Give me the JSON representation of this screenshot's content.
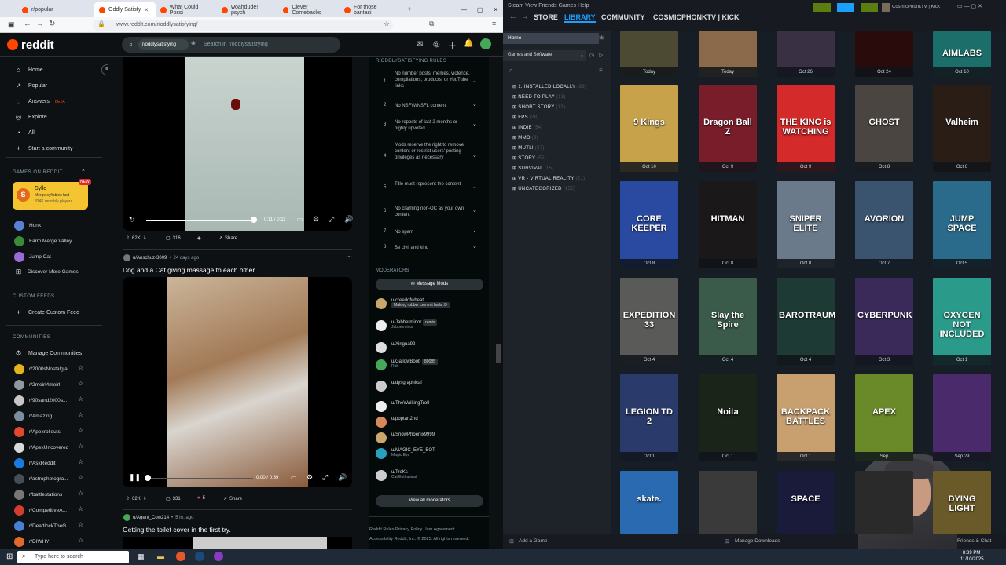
{
  "browser": {
    "tabs": [
      {
        "label": "r/popular"
      },
      {
        "label": "Oddly Satisfy"
      },
      {
        "label": "What Could Possi"
      },
      {
        "label": "woahdude! psych"
      },
      {
        "label": "Clever Comebacks"
      },
      {
        "label": "For those bantasi"
      }
    ],
    "url": "www.reddit.com/r/oddlysatisfying/"
  },
  "reddit": {
    "logo": "reddit",
    "search_chip": "r/oddlysatisfying",
    "search_placeholder": "Search in r/oddlysatisfying",
    "nav": [
      {
        "label": "Home",
        "icon": "home-icon"
      },
      {
        "label": "Popular",
        "icon": "popular-icon"
      },
      {
        "label": "Answers",
        "badge": "BETA",
        "icon": "answers-icon"
      },
      {
        "label": "Explore",
        "icon": "explore-icon"
      },
      {
        "label": "All",
        "icon": "all-icon"
      },
      {
        "label": "Start a community",
        "icon": "plus-icon"
      }
    ],
    "games_heading": "GAMES ON REDDIT",
    "game_card": {
      "title": "Syllo",
      "desc": "Merge syllables fast",
      "players": "334K monthly players",
      "badge": "NEW"
    },
    "games": [
      {
        "label": "Honk"
      },
      {
        "label": "Farm Merge Valley"
      },
      {
        "label": "Jump Cat"
      },
      {
        "label": "Discover More Games"
      }
    ],
    "custom_feeds_heading": "CUSTOM FEEDS",
    "create_feed": "Create Custom Feed",
    "communities_heading": "COMMUNITIES",
    "manage": "Manage Communities",
    "communities": [
      {
        "label": "r/2000sNostalgia",
        "color": "#e4b21a"
      },
      {
        "label": "r/2meirl4meirl",
        "color": "#8f9aa0"
      },
      {
        "label": "r/90sand2000s...",
        "color": "#c7c7c7"
      },
      {
        "label": "r/Amazing",
        "color": "#7a8ea0"
      },
      {
        "label": "r/Apexrollouts",
        "color": "#e2482d"
      },
      {
        "label": "r/ApexUncovered",
        "color": "#d7dadc"
      },
      {
        "label": "r/AskReddit",
        "color": "#1a7ae0"
      },
      {
        "label": "r/astrophotogra...",
        "color": "#444e57"
      },
      {
        "label": "r/battlestations",
        "color": "#777"
      },
      {
        "label": "r/CompetitiveA...",
        "color": "#d13e2e"
      },
      {
        "label": "r/DeadlockTheG...",
        "color": "#4a7fd6"
      },
      {
        "label": "r/DIWHY",
        "color": "#e0692c"
      }
    ],
    "post1": {
      "time_current": "0:11",
      "time_total": "0:11",
      "votes": "62K",
      "comments": "316",
      "share": "Share"
    },
    "post2": {
      "author": "u/Anschuz-3009",
      "age": "24 days ago",
      "title": "Dog and a Cat giving massage to each other",
      "time_current": "0:00",
      "time_total": "0:39",
      "votes": "62K",
      "comments": "331",
      "awards": "5",
      "share": "Share"
    },
    "post3": {
      "author": "u/Agent_Cow214",
      "age": "5 hr. ago",
      "title": "Getting the toilet cover in the first try."
    },
    "rules_heading": "R/ODDLYSATISFYING RULES",
    "rules": [
      {
        "n": "1",
        "text": "No number posts, memes, violence, compilations, products, or YouTube links"
      },
      {
        "n": "2",
        "text": "No NSFW/NSFL content"
      },
      {
        "n": "3",
        "text": "No reposts of last 2 months or highly upvoted"
      },
      {
        "n": "4",
        "text": "Mods reserve the right to remove content or restrict users' posting privileges as necessary"
      },
      {
        "n": "5",
        "text": "Title must represent the content"
      },
      {
        "n": "6",
        "text": "No claiming non-OC as your own content"
      },
      {
        "n": "7",
        "text": "No spam"
      },
      {
        "n": "8",
        "text": "Be civil and kind"
      }
    ],
    "moderators_heading": "MODERATORS",
    "message_mods": "Message Mods",
    "moderators": [
      {
        "name": "u/creedofwheat",
        "flair": "Making rubber cement balls :D"
      },
      {
        "name": "u/Jabberminor",
        "flair": "remix",
        "sub": "Jabberminor"
      },
      {
        "name": "u/Xingua92"
      },
      {
        "name": "u/GallowBoob",
        "flair": "80085",
        "sub": "Rob"
      },
      {
        "name": "u/dysgraphical"
      },
      {
        "name": "u/TheWalkingTroll"
      },
      {
        "name": "u/poptart2nd"
      },
      {
        "name": "u/SnowPhoenix9999"
      },
      {
        "name": "u/MAGIC_EYE_BOT",
        "sub": "Magic Eye"
      },
      {
        "name": "u/TreKs",
        "sub": "Cat Enthusiast"
      }
    ],
    "view_mods": "View all moderators",
    "footer1": "Reddit Rules   Privacy Policy   User Agreement",
    "footer2": "Accessibility   Reddit, Inc. © 2025. All rights reserved."
  },
  "taskbar": {
    "search": "Type here to search"
  },
  "steam": {
    "menu": [
      "Steam",
      "View",
      "Friends",
      "Games",
      "Help"
    ],
    "nav": [
      "STORE",
      "LIBRARY",
      "COMMUNITY",
      "COSMICPHONKTV | KICK"
    ],
    "user": "CosmicPhonkTV | Kick",
    "home": "Home",
    "filter": "Games and Software",
    "categories": [
      {
        "label": "1. INSTALLED LOCALLY",
        "count": "(93)"
      },
      {
        "label": "NEED TO PLAY",
        "count": "(13)"
      },
      {
        "label": "SHORT STORY",
        "count": "(12)"
      },
      {
        "label": "FPS",
        "count": "(28)"
      },
      {
        "label": "INDIE",
        "count": "(54)"
      },
      {
        "label": "MMO",
        "count": "(8)"
      },
      {
        "label": "MUTLI",
        "count": "(37)"
      },
      {
        "label": "STORY",
        "count": "(55)"
      },
      {
        "label": "SURVIVAL",
        "count": "(15)"
      },
      {
        "label": "VR - VIRTUAL REALITY",
        "count": "(21)"
      },
      {
        "label": "UNCATEGORIZED",
        "count": "(155)"
      }
    ],
    "row0": [
      {
        "date": "Today",
        "bg": "#4c4a32"
      },
      {
        "date": "Today",
        "bg": "#8a6a4a"
      },
      {
        "date": "Oct 26",
        "bg": "#3a3044"
      },
      {
        "date": "Oct 24",
        "bg": "#2a0b0b"
      },
      {
        "date": "Oct 10",
        "bg": "#1b6e6a",
        "title": "AIMLABS"
      }
    ],
    "games": [
      {
        "title": "9 Kings",
        "date": "Oct 10",
        "bg": "#c7a24b"
      },
      {
        "title": "Dragon Ball Z",
        "date": "Oct 9",
        "bg": "#7a1d2a"
      },
      {
        "title": "THE KING is WATCHING",
        "date": "Oct 9",
        "bg": "#d42a2a"
      },
      {
        "title": "GHOST",
        "date": "Oct 8",
        "bg": "#4a4540"
      },
      {
        "title": "Valheim",
        "date": "Oct 8",
        "bg": "#2a1d16"
      },
      {
        "title": "CORE KEEPER",
        "date": "Oct 8",
        "bg": "#2a4aa2"
      },
      {
        "title": "HITMAN",
        "date": "Oct 8",
        "bg": "#1a1818"
      },
      {
        "title": "SNIPER ELITE",
        "date": "Oct 8",
        "bg": "#6a7a8a"
      },
      {
        "title": "AVORION",
        "date": "Oct 7",
        "bg": "#3a5470"
      },
      {
        "title": "JUMP SPACE",
        "date": "Oct 5",
        "bg": "#2a6a8a"
      },
      {
        "title": "EXPEDITION 33",
        "date": "Oct 4",
        "bg": "#5a5a58"
      },
      {
        "title": "Slay the Spire",
        "date": "Oct 4",
        "bg": "#3a5a4a"
      },
      {
        "title": "BAROTRAUMA",
        "date": "Oct 4",
        "bg": "#1e3a34"
      },
      {
        "title": "CYBERPUNK",
        "date": "Oct 3",
        "bg": "#3a2a5a"
      },
      {
        "title": "OXYGEN NOT INCLUDED",
        "date": "Oct 1",
        "bg": "#2a9a8a"
      },
      {
        "title": "LEGION TD 2",
        "date": "Oct 1",
        "bg": "#2a3a6a"
      },
      {
        "title": "Noita",
        "date": "Oct 1",
        "bg": "#1a2418"
      },
      {
        "title": "BACKPACK BATTLES",
        "date": "Oct 1",
        "bg": "#c8a070"
      },
      {
        "title": "APEX",
        "date": "Sep",
        "bg": "#6a8a2a"
      },
      {
        "title": "",
        "date": "Sep 29",
        "bg": "#4a2a6a"
      },
      {
        "title": "skate.",
        "date": "",
        "bg": "#2a6ab0"
      },
      {
        "title": "",
        "date": "",
        "bg": "#3a3a3a"
      },
      {
        "title": "SPACE",
        "date": "",
        "bg": "#1a1a3a"
      },
      {
        "title": "",
        "date": "",
        "bg": "#2a2a2a"
      },
      {
        "title": "DYING LIGHT",
        "date": "",
        "bg": "#6a5a2a"
      }
    ],
    "add_game": "Add a Game",
    "manage_downloads": "Manage Downloads",
    "friends_chat": "Friends & Chat",
    "clock": "8:39 PM",
    "date": "11/10/2025"
  }
}
